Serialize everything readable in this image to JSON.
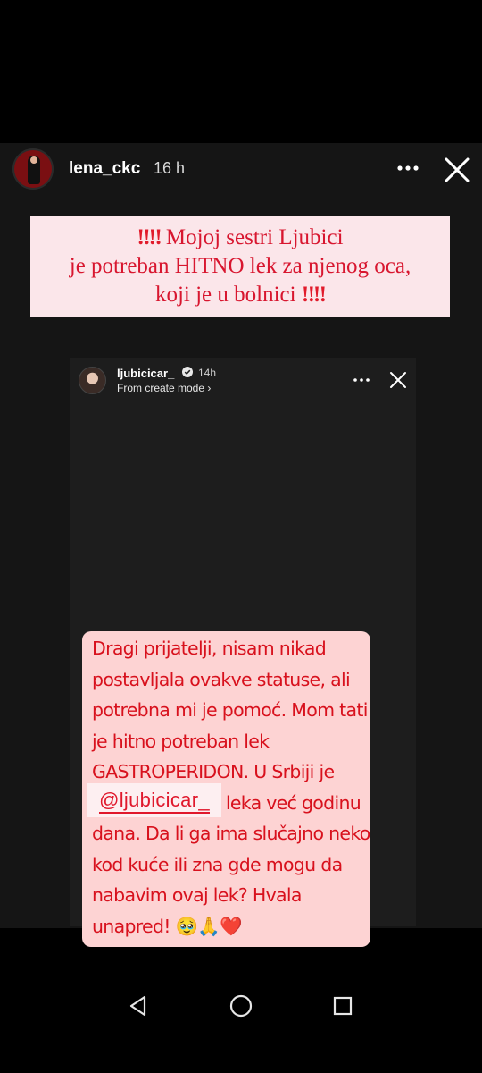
{
  "story": {
    "username": "lena_ckc",
    "time": "16 h",
    "banner": {
      "alarm": "‼‼",
      "line1": "Mojoj sestri Ljubici",
      "line2": "je potreban HITNO lek za njenog oca,",
      "line3": "koji je u bolnici"
    }
  },
  "shared_post": {
    "username": "ljubicicar_",
    "time": "14h",
    "subtitle": "From create mode ›",
    "message": "Dragi prijatelji, nisam nikad\npostavljala ovakve statuse, ali\npotrebna mi je pomoć. Mom tati\nje hitno potreban lek\nGASTROPERIDON. U Srbiji je\nnestašica ovog leka već godinu\ndana. Da li ga ima slučajno neko\nkod kuće ili zna gde mogu da\nnabavim ovaj lek? Hvala\nunapred!  🥹🙏❤️"
  },
  "mention": "@ljubicicar_",
  "colors": {
    "banner_bg": "#fbe6ea",
    "banner_text": "#d8162f",
    "message_bg": "#fdd3d3",
    "message_text": "#d8111d"
  },
  "icons": [
    "more-icon",
    "close-icon",
    "verified-icon",
    "back-icon",
    "home-icon",
    "recents-icon"
  ]
}
